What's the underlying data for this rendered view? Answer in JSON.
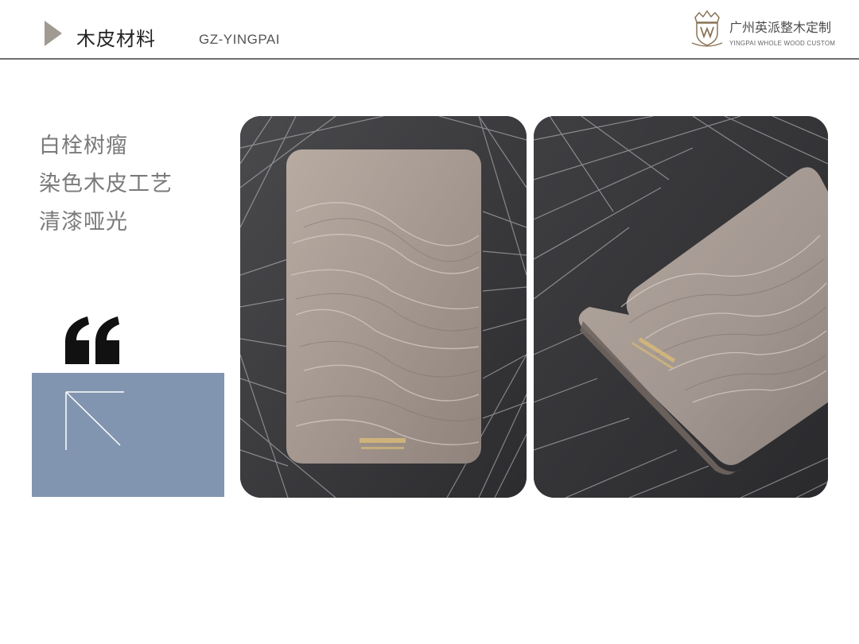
{
  "header": {
    "title": "木皮材料",
    "subtitle": "GZ-YINGPAI",
    "brand_cn": "广州英派整木定制",
    "brand_en": "YINGPAI WHOLE WOOD CUSTOM"
  },
  "description": {
    "lines": [
      "白栓树瘤",
      "染色木皮工艺",
      "清漆哑光"
    ]
  },
  "colors": {
    "accent_triangle": "#a09a92",
    "panel_blue": "#8295b0",
    "header_rule": "#6e6e6e",
    "text_gray": "#7a7a7a"
  },
  "icons": {
    "logo": "crown-shield-logo-icon",
    "quote": "quotation-mark-icon",
    "corner": "corner-arrow-icon"
  }
}
